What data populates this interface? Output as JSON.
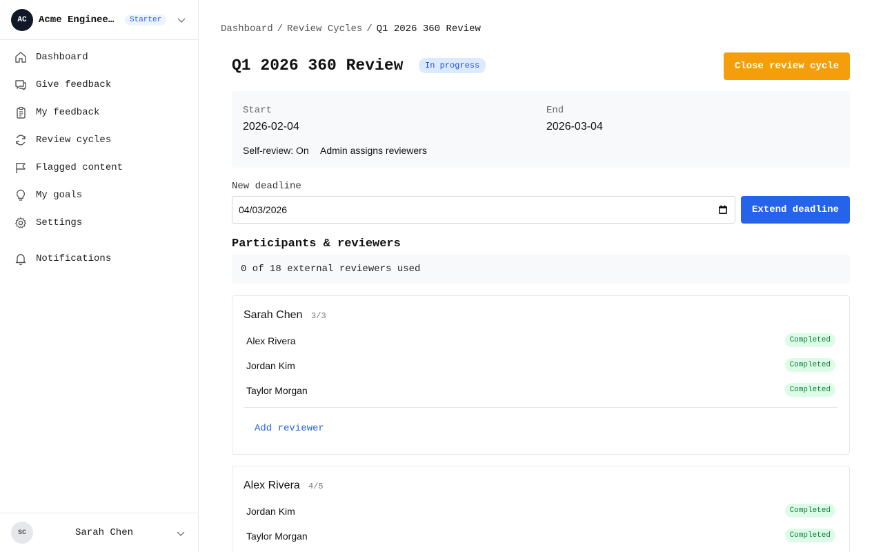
{
  "org": {
    "initials": "AC",
    "name": "Acme Engineering",
    "plan": "Starter"
  },
  "nav": [
    {
      "label": "Dashboard",
      "icon": "home-icon"
    },
    {
      "label": "Give feedback",
      "icon": "chat-icon"
    },
    {
      "label": "My feedback",
      "icon": "clipboard-icon"
    },
    {
      "label": "Review cycles",
      "icon": "refresh-icon"
    },
    {
      "label": "Flagged content",
      "icon": "flag-icon"
    },
    {
      "label": "My goals",
      "icon": "lightbulb-icon"
    },
    {
      "label": "Settings",
      "icon": "gear-icon"
    },
    {
      "label": "Notifications",
      "icon": "bell-icon"
    }
  ],
  "user": {
    "initials": "SC",
    "name": "Sarah Chen"
  },
  "breadcrumb": {
    "items": [
      "Dashboard",
      "Review Cycles"
    ],
    "separator": "/",
    "current": "Q1 2026 360 Review"
  },
  "cycle": {
    "title": "Q1 2026 360 Review",
    "status": "In progress",
    "close_label": "Close review cycle",
    "start_label": "Start",
    "start_value": "2026-02-04",
    "end_label": "End",
    "end_value": "2026-03-04",
    "self_review": "Self-review: On",
    "assignment": "Admin assigns reviewers"
  },
  "deadline": {
    "label": "New deadline",
    "value": "04/03/2026",
    "button": "Extend deadline"
  },
  "participants": {
    "title": "Participants & reviewers",
    "quota": "0 of 18 external reviewers used",
    "add_label": "Add reviewer",
    "cards": [
      {
        "name": "Sarah Chen",
        "count": "3/3",
        "reviewers": [
          {
            "name": "Alex Rivera",
            "status": "Completed"
          },
          {
            "name": "Jordan Kim",
            "status": "Completed"
          },
          {
            "name": "Taylor Morgan",
            "status": "Completed"
          }
        ]
      },
      {
        "name": "Alex Rivera",
        "count": "4/5",
        "reviewers": [
          {
            "name": "Jordan Kim",
            "status": "Completed"
          },
          {
            "name": "Taylor Morgan",
            "status": "Completed"
          }
        ]
      }
    ]
  },
  "colors": {
    "accent": "#2563eb",
    "warning": "#f59e0b",
    "success_bg": "#dcfce7",
    "success_text": "#15803d"
  }
}
